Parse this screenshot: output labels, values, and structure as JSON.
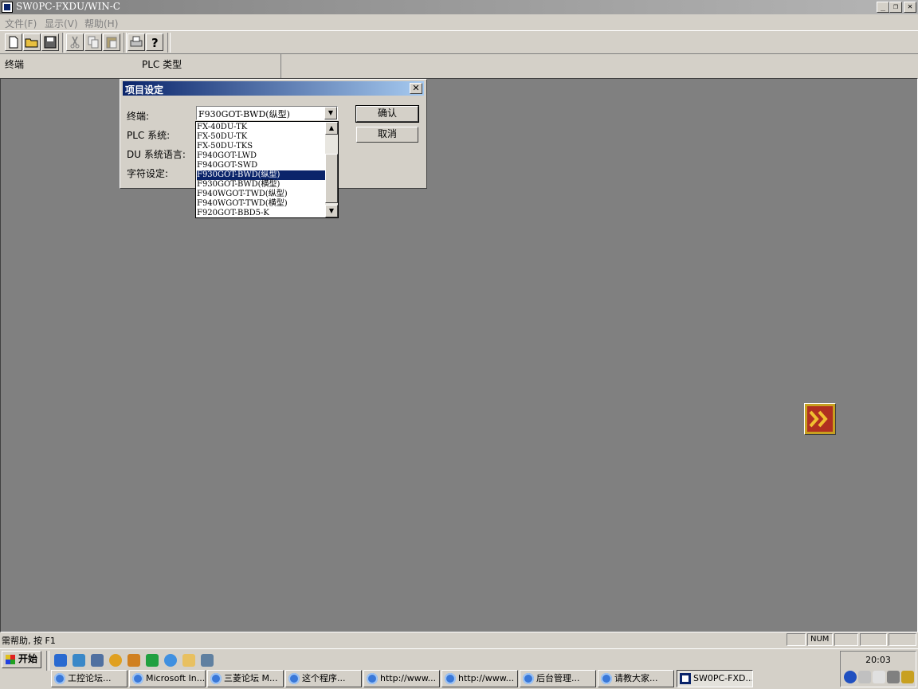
{
  "window": {
    "title": "SW0PC-FXDU/WIN-C",
    "minimize": "_",
    "restore": "❐",
    "close": "✕"
  },
  "menu": [
    "文件(F)",
    "显示(V)",
    "帮助(H)"
  ],
  "toolbar": [
    "new-icon",
    "open-icon",
    "save-icon",
    "cut-icon",
    "copy-icon",
    "paste-icon",
    "print-icon",
    "help-icon"
  ],
  "header": {
    "col1": "终端",
    "col2": "PLC 类型"
  },
  "dialog": {
    "title": "项目设定",
    "close": "✕",
    "labels": {
      "terminal": "终端:",
      "plc": "PLC 系统:",
      "du_lang": "DU 系统语言:",
      "charset": "字符设定:"
    },
    "ok": "确认",
    "cancel": "取消",
    "terminal_value": "F930GOT-BWD(纵型)",
    "list_items": [
      "FX-40DU-TK",
      "FX-50DU-TK",
      "FX-50DU-TKS",
      "F940GOT-LWD",
      "F940GOT-SWD",
      "F930GOT-BWD(纵型)",
      "F930GOT-BWD(横型)",
      "F940WGOT-TWD(纵型)",
      "F940WGOT-TWD(横型)",
      "F920GOT-BBD5-K"
    ],
    "selected_index": 5
  },
  "status": {
    "help": "需帮助, 按 F1",
    "num": "NUM"
  },
  "taskbar": {
    "start": "开始",
    "tasks": [
      "工控论坛...",
      "Microsoft In...",
      "三菱论坛 M...",
      "这个程序...",
      "http://www...",
      "http://www...",
      "后台管理...",
      "请教大家...",
      "SW0PC-FXD..."
    ],
    "active_task": 8,
    "clock": "20:03"
  },
  "colors": {
    "desktop_gray": "#808080",
    "title_active": "#0a246a",
    "face": "#d4d0c8"
  }
}
